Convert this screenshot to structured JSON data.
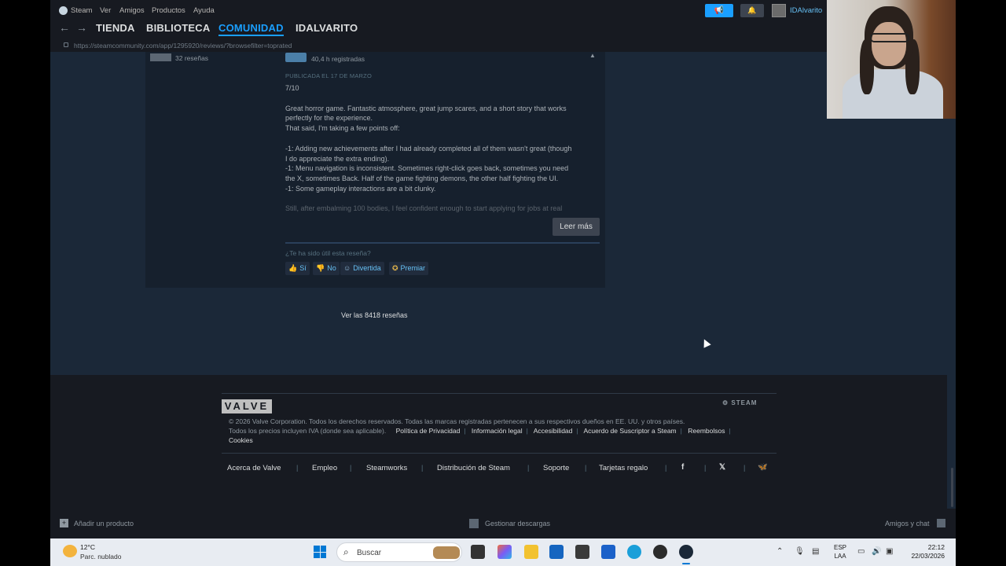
{
  "menubar": {
    "items": [
      "Steam",
      "Ver",
      "Amigos",
      "Productos",
      "Ayuda"
    ],
    "username": "IDAlvarito",
    "notify_icon": "megaphone-icon",
    "bell_icon": "bell-icon"
  },
  "nav": {
    "back_icon": "←",
    "forward_icon": "→",
    "tabs": [
      "TIENDA",
      "BIBLIOTECA",
      "COMUNIDAD",
      "IDALVARITO"
    ],
    "active_tab": "COMUNIDAD",
    "url": "https://steamcommunity.com/app/1295920/reviews/?browsefilter=toprated"
  },
  "review": {
    "reviewer_count": "32 reseñas",
    "hours": "40,4 h registradas",
    "posted": "PUBLICADA EL 17 DE MARZO",
    "score": "7/10",
    "para1_line1": "Great horror game. Fantastic atmosphere, great jump scares, and a short story that works",
    "para1_line2": "perfectly for the experience.",
    "para1_line3": "That said, I'm taking a few points off:",
    "point1_line1": "-1: Adding new achievements after I had already completed all of them wasn't great (though",
    "point1_line2": "I do appreciate the extra ending).",
    "point2_line1": "-1: Menu navigation is inconsistent. Sometimes right-click goes back, sometimes you need",
    "point2_line2": "the X, sometimes Back. Half of the game fighting demons, the other half fighting the UI.",
    "point3": "-1: Some gameplay interactions are a bit clunky.",
    "faded": "Still, after embalming 100 bodies, I feel confident enough to start applying for jobs at real",
    "read_more": "Leer más",
    "helpful_q": "¿Te ha sido útil esta reseña?",
    "vote_yes": "Sí",
    "vote_no": "No",
    "vote_funny": "Divertida",
    "vote_award": "Premiar"
  },
  "see_all": "Ver las 8418 reseñas",
  "footer": {
    "valve": "VALVE",
    "steam": "STEAM",
    "legal1": "© 2026 Valve Corporation. Todos los derechos reservados. Todas las marcas registradas pertenecen a sus respectivos dueños en EE. UU. y otros países.",
    "legal2_prefix": "Todos los precios incluyen IVA (donde sea aplicable).",
    "legal_links": [
      "Política de Privacidad",
      "Información legal",
      "Accesibilidad",
      "Acuerdo de Suscriptor a Steam",
      "Reembolsos"
    ],
    "cookies": "Cookies",
    "links": [
      "Acerca de Valve",
      "Empleo",
      "Steamworks",
      "Distribución de Steam",
      "Soporte",
      "Tarjetas regalo"
    ],
    "social": [
      "f",
      "𝕏",
      "🦋"
    ]
  },
  "bottombar": {
    "add_product": "Añadir un producto",
    "downloads": "Gestionar descargas",
    "friends": "Amigos y chat"
  },
  "taskbar": {
    "temp": "12°C",
    "condition": "Parc. nublado",
    "search_placeholder": "Buscar",
    "lang_line1": "ESP",
    "lang_line2": "LAA",
    "time": "22:12",
    "date": "22/03/2026"
  }
}
